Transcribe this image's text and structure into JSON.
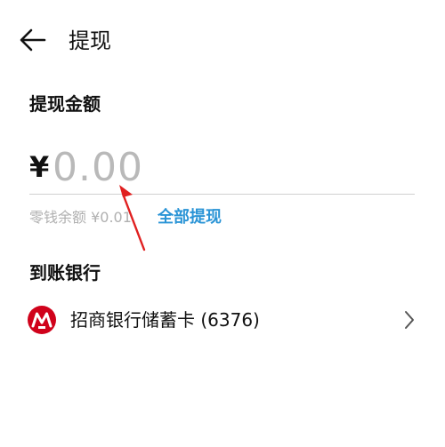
{
  "header": {
    "title": "提现",
    "back_icon": "arrow-left-icon"
  },
  "amount": {
    "label": "提现金额",
    "currency": "¥",
    "placeholder": "0.00",
    "value": ""
  },
  "balance": {
    "text": "零钱余额 ¥0.01",
    "withdraw_all": "全部提现"
  },
  "bank": {
    "label": "到账银行",
    "name": "招商银行储蓄卡 (6376)",
    "logo_icon": "cmb-bank-logo-icon",
    "chevron_icon": "chevron-right-icon"
  },
  "colors": {
    "link": "#2a94d6",
    "annotation": "#e02020",
    "bank_logo": "#d0021b",
    "placeholder": "#b9b9b9"
  }
}
